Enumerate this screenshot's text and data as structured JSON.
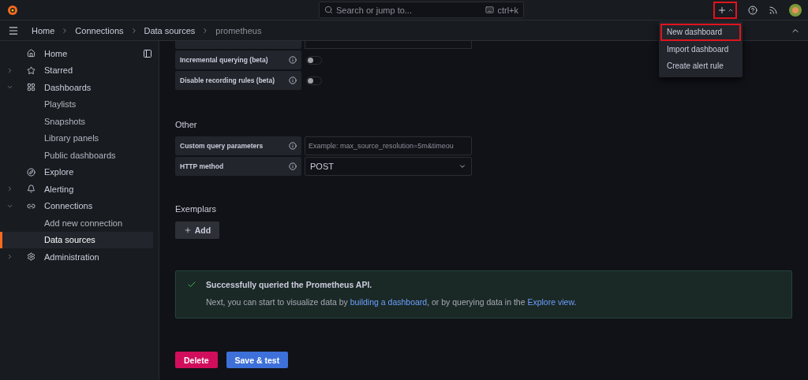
{
  "topbar": {
    "search": {
      "placeholder": "Search or jump to...",
      "shortcut": "ctrl+k"
    },
    "new_button": {
      "highlighted": true,
      "expanded": true
    },
    "menu": {
      "items": [
        {
          "label": "New dashboard",
          "highlighted": true
        },
        {
          "label": "Import dashboard",
          "highlighted": false
        },
        {
          "label": "Create alert rule",
          "highlighted": false
        }
      ]
    }
  },
  "breadcrumbs": [
    "Home",
    "Connections",
    "Data sources",
    "prometheus"
  ],
  "sidebar": {
    "items": [
      {
        "label": "Home",
        "selected": false
      },
      {
        "label": "Starred",
        "expanded": false,
        "selected": false
      },
      {
        "label": "Dashboards",
        "expanded": true,
        "selected": false,
        "children": [
          {
            "label": "Playlists",
            "selected": false
          },
          {
            "label": "Snapshots",
            "selected": false
          },
          {
            "label": "Library panels",
            "selected": false
          },
          {
            "label": "Public dashboards",
            "selected": false
          }
        ]
      },
      {
        "label": "Explore",
        "selected": false
      },
      {
        "label": "Alerting",
        "expanded": false,
        "selected": false
      },
      {
        "label": "Connections",
        "expanded": true,
        "selected": false,
        "children": [
          {
            "label": "Add new connection",
            "selected": false
          },
          {
            "label": "Data sources",
            "selected": true
          }
        ]
      },
      {
        "label": "Administration",
        "expanded": false,
        "selected": false
      }
    ]
  },
  "sections": [
    {
      "rows": [
        {
          "kind": "partial"
        },
        {
          "kind": "toggle",
          "label": "Incremental querying (beta)",
          "on": false
        },
        {
          "kind": "toggle",
          "label": "Disable recording rules (beta)",
          "on": false
        }
      ]
    },
    {
      "title": "Other",
      "rows": [
        {
          "kind": "input",
          "label": "Custom query parameters",
          "placeholder": "Example: max_source_resolution=5m&timeou"
        },
        {
          "kind": "select",
          "label": "HTTP method",
          "value": "POST"
        }
      ]
    }
  ],
  "exemplars": {
    "title": "Exemplars",
    "add_label": "Add"
  },
  "alert": {
    "title": "Successfully queried the Prometheus API.",
    "parts": [
      {
        "text": "Next, you can start to visualize data by "
      },
      {
        "link": "building a dashboard"
      },
      {
        "text": ", or by querying data in the "
      },
      {
        "link": "Explore view"
      },
      {
        "text": "."
      }
    ]
  },
  "actions": [
    {
      "kind": "danger",
      "label": "Delete"
    },
    {
      "kind": "primary",
      "label": "Save & test"
    }
  ]
}
